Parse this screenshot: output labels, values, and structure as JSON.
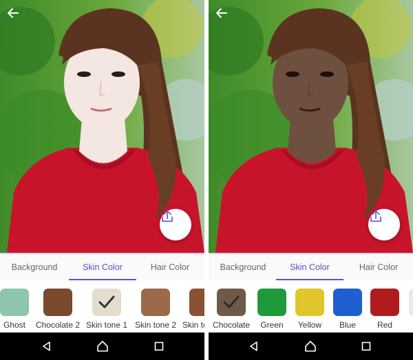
{
  "tabs": [
    "Background",
    "Skin Color",
    "Hair Color"
  ],
  "active_tab": "Skin Color",
  "left_swatches": [
    {
      "label": "Ghost",
      "color": "#8fc4ad",
      "selected": false
    },
    {
      "label": "Chocolate 2",
      "color": "#7a4a2e",
      "selected": false
    },
    {
      "label": "Skin tone 1",
      "color": "#e5dcd0",
      "selected": true
    },
    {
      "label": "Skin tone 2",
      "color": "#9a6a4a",
      "selected": false
    },
    {
      "label": "Skin tc",
      "color": "#8a5232",
      "selected": false
    }
  ],
  "right_swatches": [
    {
      "label": "Chocolate",
      "color": "#6e5a48",
      "selected": true
    },
    {
      "label": "Green",
      "color": "#1f9a3a",
      "selected": false
    },
    {
      "label": "Yellow",
      "color": "#e0c62a",
      "selected": false
    },
    {
      "label": "Blue",
      "color": "#1f5fd0",
      "selected": false
    },
    {
      "label": "Red",
      "color": "#b01c1c",
      "selected": false
    }
  ],
  "colors": {
    "accent": "#5b4fc9",
    "shirt": "#c8142a",
    "hair": "#5a3420",
    "skin_left": "#f4e6e0",
    "skin_right": "#6e5040"
  },
  "icons": {
    "back": "arrow-left-icon",
    "share": "share-icon",
    "nav_back": "triangle-back-icon",
    "nav_home": "circle-home-icon",
    "nav_recent": "square-recent-icon"
  }
}
